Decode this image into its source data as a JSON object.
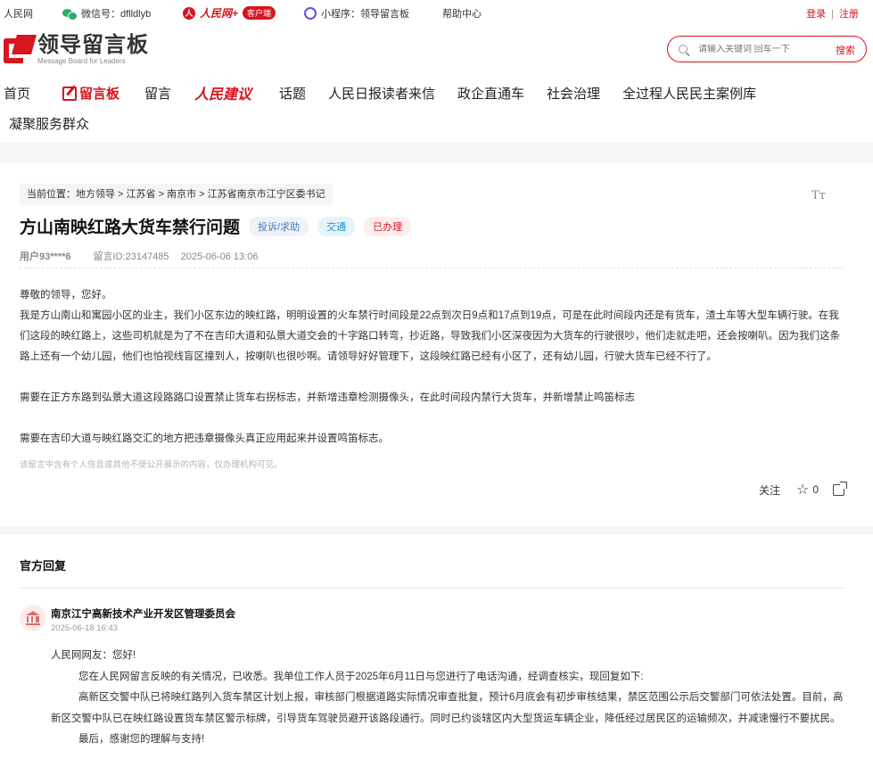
{
  "topbar": {
    "site": "人民网",
    "wechat": "微信号：dflldlyb",
    "app_name": "人民网+",
    "app_tag": "客户端",
    "mini_program": "小程序：领导留言板",
    "help": "帮助中心",
    "login": "登录",
    "separator": "|",
    "register": "注册"
  },
  "header": {
    "logo_cn": "领导留言板",
    "logo_en": "Message Board for Leaders",
    "search_placeholder": "请输入关键词 回车一下",
    "search_button": "搜索"
  },
  "nav": {
    "items": [
      "首页",
      "留言板",
      "留言",
      "人民建议",
      "话题",
      "人民日报读者来信",
      "政企直通车",
      "社会治理",
      "全过程人民民主案例库",
      "凝聚服务群众"
    ],
    "active": "留言板"
  },
  "post": {
    "breadcrumb": "当前位置：地方领导 > 江苏省 > 南京市 > 江苏省南京市江宁区委书记",
    "font_size_icon": "Tт",
    "title": "方山南映红路大货车禁行问题",
    "tags": [
      "投诉/求助",
      "交通",
      "已办理"
    ],
    "user": "用户93****6",
    "message_id": "留言ID:23147485",
    "datetime": "2025-06-06 13:06",
    "paragraphs": [
      "尊敬的领导，您好。",
      "我是方山南山和寓园小区的业主，我们小区东边的映红路，明明设置的火车禁行时间段是22点到次日9点和17点到19点，可是在此时间段内还是有货车，渣土车等大型车辆行驶。在我们这段的映红路上，这些司机就是为了不在吉印大道和弘景大道交会的十字路口转弯，抄近路，导致我们小区深夜因为大货车的行驶很吵，他们走就走吧，还会按喇叭。因为我们这条路上还有一个幼儿园，他们也怕视线盲区撞到人，按喇叭也很吵啊。请领导好好管理下，这段映红路已经有小区了，还有幼儿园，行驶大货车已经不行了。",
      "",
      "需要在正方东路到弘景大道这段路路口设置禁止货车右拐标志，并新增违章检测摄像头，在此时间段内禁行大货车，并新增禁止鸣笛标志",
      "",
      "需要在吉印大道与映红路交汇的地方把违章摄像头真正应用起来并设置鸣笛标志。"
    ],
    "note": "该留言中含有个人信息或其他不便公开展示的内容，仅办理机构可见。",
    "follow": "关注",
    "favorite_count": "0"
  },
  "reply": {
    "section_title": "官方回复",
    "org": "南京江宁高新技术产业开发区管理委员会",
    "date": "2025-06-18 16:43",
    "greeting": "人民网网友：您好!",
    "p1": "您在人民网留言反映的有关情况，已收悉。我单位工作人员于2025年6月11日与您进行了电话沟通，经调查核实，现回复如下:",
    "p2": "高新区交警中队已将映红路列入货车禁区计划上报，审核部门根据道路实际情况审查批复，预计6月底会有初步审核结果，禁区范围公示后交警部门可依法处置。目前，高新区交警中队已在映红路设置货车禁区警示标牌，引导货车驾驶员避开该路段通行。同时已约谈辖区内大型货运车辆企业，降低经过居民区的运输频次，并减速慢行不要扰民。",
    "p3": "最后，感谢您的理解与支持!"
  }
}
